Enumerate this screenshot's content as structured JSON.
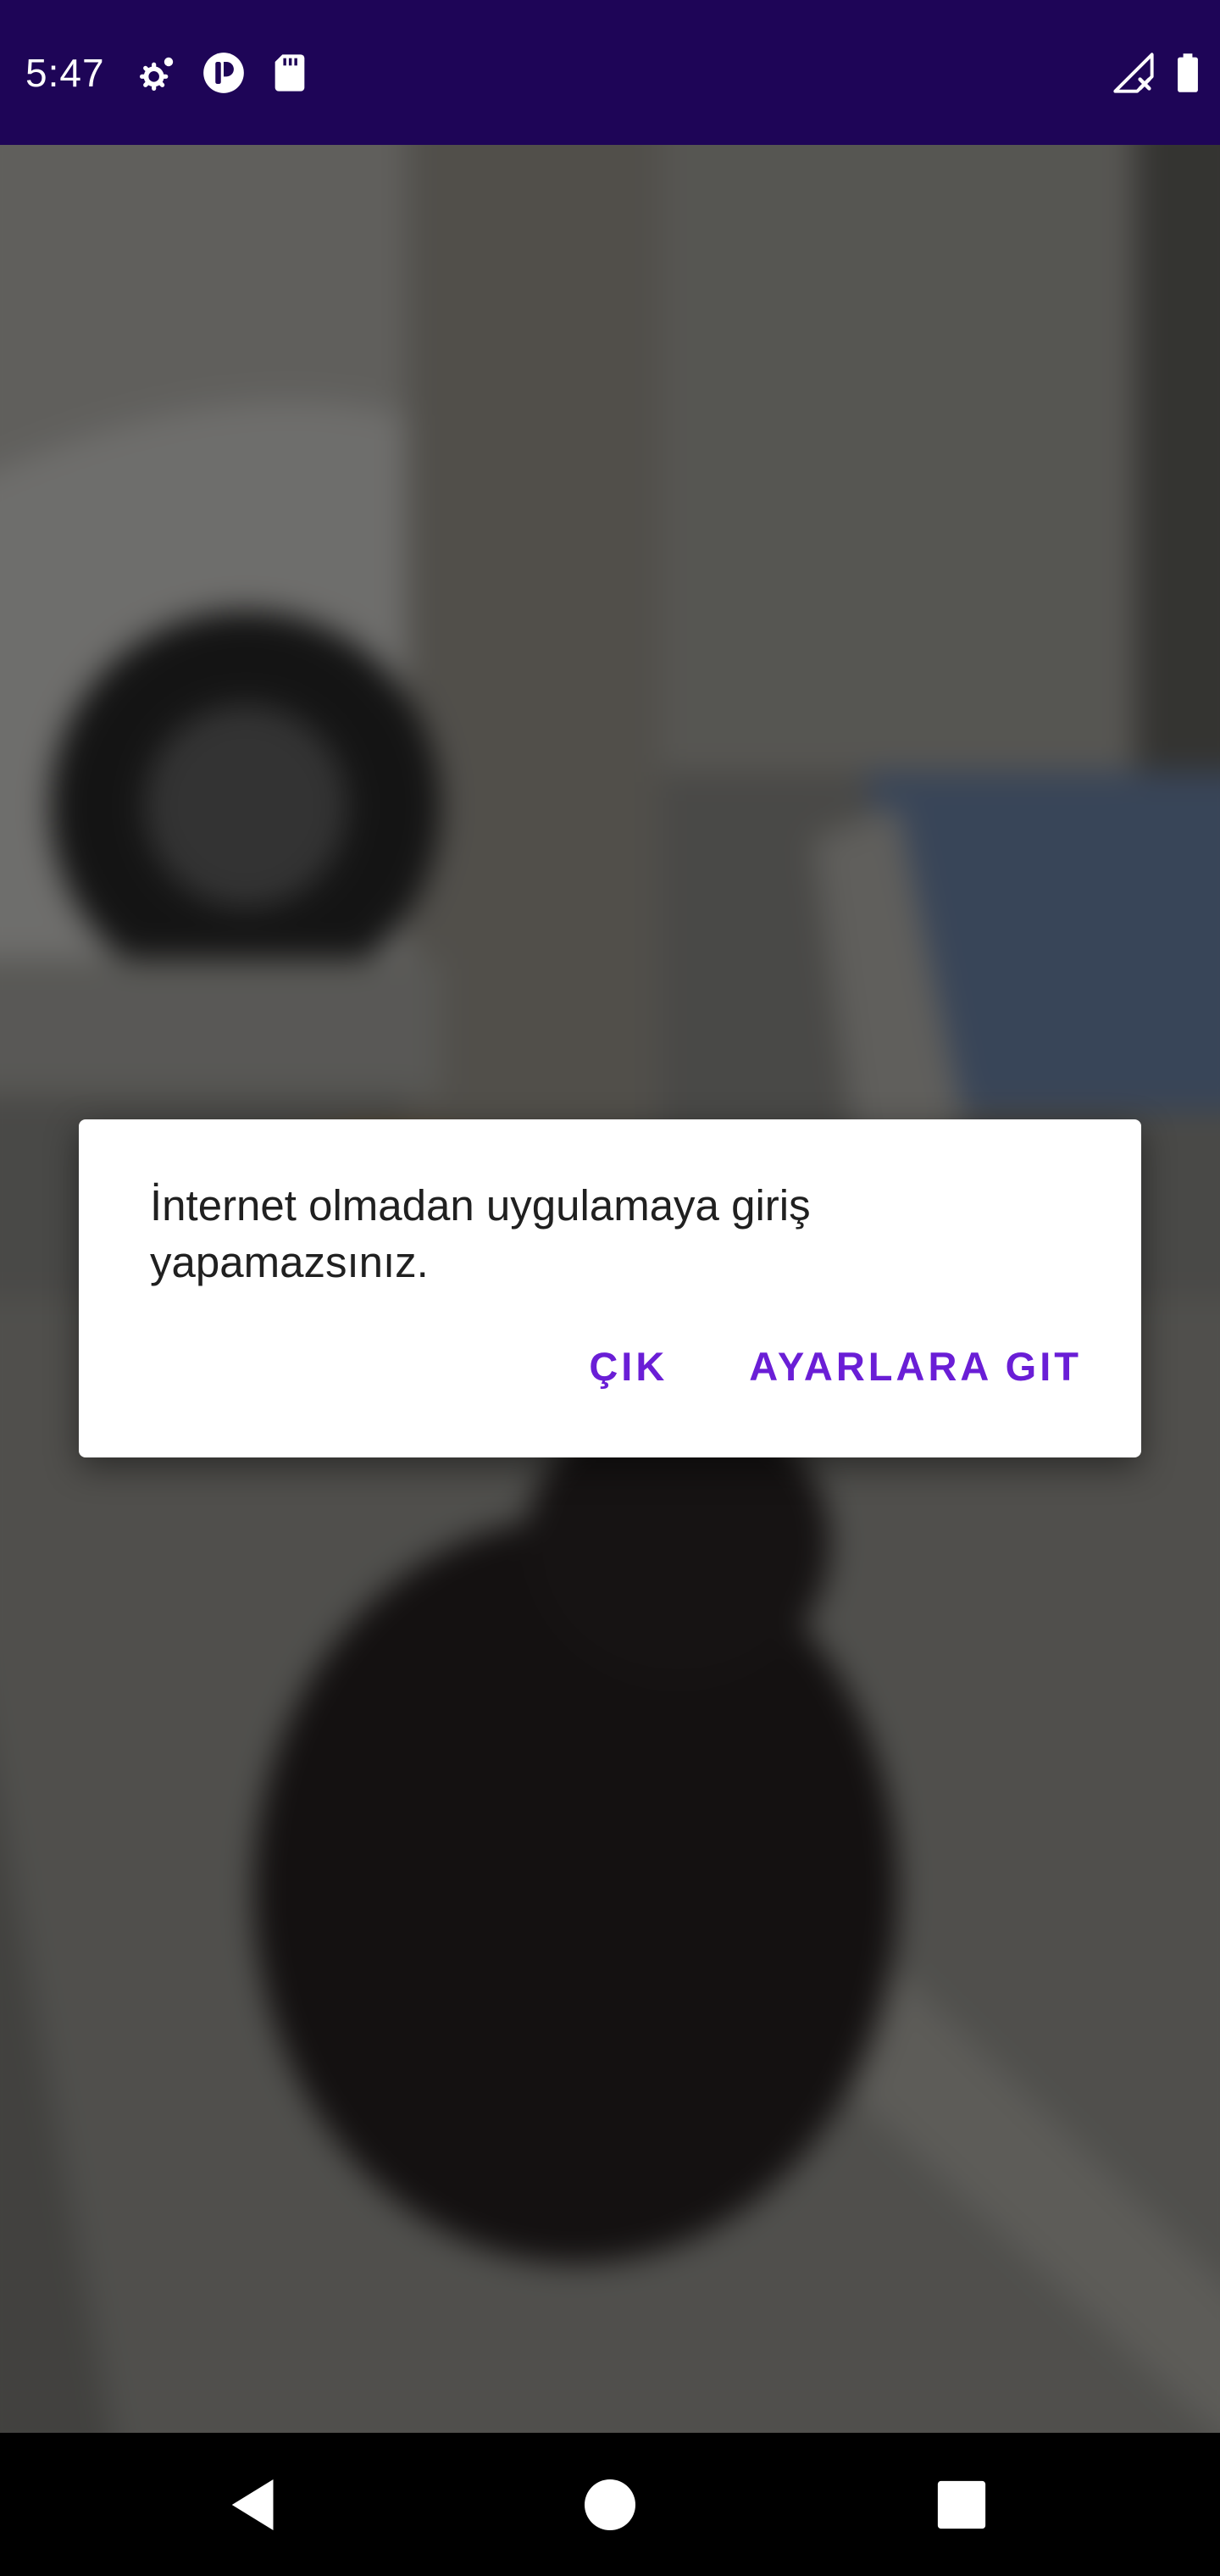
{
  "status_bar": {
    "time": "5:47",
    "left_icons": [
      "settings-sync-icon",
      "vpn-key-icon",
      "sd-card-icon"
    ],
    "right_icons": [
      "cellular-no-signal-icon",
      "battery-full-icon"
    ],
    "background_color": "#1e0557"
  },
  "dialog": {
    "message": "İnternet olmadan uygulamaya giriş yapamazsınız.",
    "negative_button": "ÇIK",
    "positive_button": "AYARLARA GIT",
    "button_color": "#6a1ed6"
  },
  "navigation_bar": {
    "buttons": [
      "back-icon",
      "home-icon",
      "recents-icon"
    ]
  }
}
